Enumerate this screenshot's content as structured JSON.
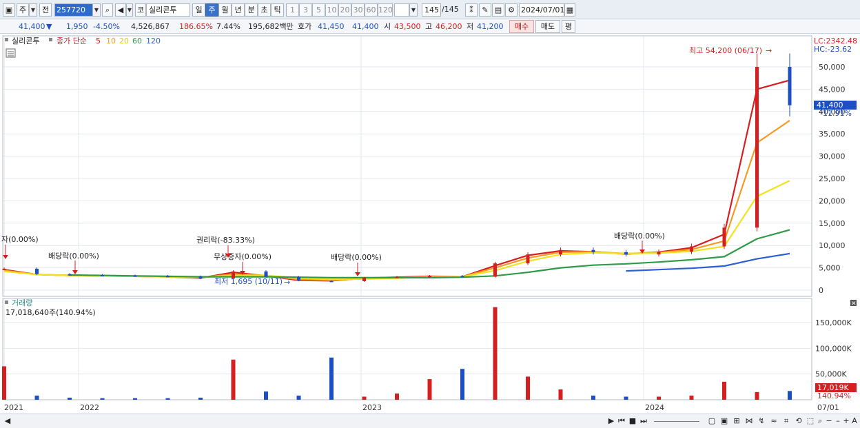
{
  "toolbar": {
    "market": "주",
    "prev": "전",
    "code": "257720",
    "corp_prefix": "코",
    "name": "실리콘투",
    "periods": [
      "일",
      "주",
      "월",
      "년",
      "분",
      "초",
      "틱"
    ],
    "active_period": "주",
    "intervals": [
      "1",
      "3",
      "5",
      "10",
      "20",
      "30",
      "60",
      "120"
    ],
    "count": "145",
    "count_total": "/145",
    "date": "2024/07/01"
  },
  "quote": {
    "price": "41,400",
    "change": "1,950",
    "change_rate": "-4.50%",
    "volume": "4,526,867",
    "vol_ratio": "186.65%",
    "turnover": "7.44%",
    "amount": "195,682백만",
    "hoga_label": "호가",
    "ask": "41,450",
    "bid": "41,400",
    "open_label": "시",
    "open": "43,500",
    "high_label": "고",
    "high": "46,200",
    "low_label": "저",
    "low": "41,200",
    "buy": "매수",
    "sell": "매도",
    "eval": "평"
  },
  "chart": {
    "legend_name": "실리콘투",
    "ma_label": "종가 단순",
    "ma_periods": [
      {
        "label": "5",
        "color": "#d81e1e"
      },
      {
        "label": "10",
        "color": "#f59a25"
      },
      {
        "label": "20",
        "color": "#f2e21d"
      },
      {
        "label": "60",
        "color": "#2f9a48"
      },
      {
        "label": "120",
        "color": "#2c5fd4"
      }
    ],
    "lc": "LC:2342.48",
    "hc": "HC:-23.62",
    "price_tag": "41,400",
    "pct_tag": "-11.91%",
    "high_annotation": "최고 54,200 (06/17)",
    "low_annotation": "최저 1,695 (10/11)",
    "volume_title": "거래량",
    "volume_value": "17,018,640주(140.94%)",
    "volume_tag": "17,019K",
    "volume_pct_tag": "140.94%"
  },
  "events": [
    {
      "label": "자(0.00%)"
    },
    {
      "label": "배당락(0.00%)"
    },
    {
      "label": "권리락(-83.33%)"
    },
    {
      "label": "무상증자(0.00%)"
    },
    {
      "label": "배당락(0.00%)"
    },
    {
      "label": "배당락(0.00%)"
    }
  ],
  "chart_data": {
    "type": "line",
    "x_labels": [
      "2021",
      "2022",
      "2023",
      "2024",
      "07/01"
    ],
    "price_ticks": [
      "50,000",
      "45,000",
      "40,000",
      "35,000",
      "30,000",
      "25,000",
      "20,000",
      "15,000",
      "10,000",
      "5,000",
      "0"
    ],
    "price_ylim": [
      0,
      54200
    ],
    "volume_ticks": [
      "150,000K",
      "100,000K",
      "50,000K"
    ],
    "volume_ylim": [
      0,
      180000
    ],
    "x": [
      "2021-01",
      "2021-03",
      "2021-06",
      "2021-09",
      "2022-01",
      "2022-03",
      "2022-06",
      "2022-08",
      "2022-09",
      "2022-10",
      "2022-11",
      "2022-12",
      "2023-01",
      "2023-03",
      "2023-04",
      "2023-06",
      "2023-08",
      "2023-10",
      "2023-12",
      "2024-01",
      "2024-03",
      "2024-04",
      "2024-05",
      "2024-06",
      "2024-07"
    ],
    "close": [
      4800,
      3600,
      3400,
      3300,
      3200,
      3100,
      2600,
      4200,
      3000,
      2100,
      2000,
      2800,
      3000,
      3200,
      3000,
      6000,
      8000,
      9000,
      8500,
      8000,
      8600,
      9800,
      14000,
      50000,
      41400
    ],
    "series": [
      {
        "name": "5",
        "values": [
          4600,
          3500,
          3300,
          3200,
          3100,
          3000,
          2700,
          4000,
          3200,
          2200,
          2100,
          2700,
          2900,
          3100,
          3000,
          5500,
          7800,
          8800,
          8600,
          8100,
          8500,
          9500,
          12500,
          45000,
          47000
        ]
      },
      {
        "name": "10",
        "values": [
          4400,
          3500,
          3300,
          3200,
          3100,
          3000,
          2800,
          3600,
          3300,
          2400,
          2200,
          2600,
          2800,
          3000,
          3000,
          5000,
          7200,
          8500,
          8600,
          8200,
          8400,
          9100,
          11000,
          33000,
          38000
        ]
      },
      {
        "name": "20",
        "values": [
          4200,
          3500,
          3300,
          3200,
          3100,
          3000,
          2900,
          3300,
          3300,
          2700,
          2400,
          2500,
          2700,
          2900,
          3000,
          4400,
          6500,
          8000,
          8400,
          8200,
          8300,
          8700,
          9800,
          21000,
          24500
        ]
      },
      {
        "name": "60",
        "values": [
          null,
          null,
          3400,
          3300,
          3200,
          3100,
          3000,
          3000,
          3000,
          2900,
          2800,
          2800,
          2800,
          2800,
          2900,
          3200,
          4000,
          5000,
          5600,
          5900,
          6300,
          6800,
          7500,
          11500,
          13500
        ]
      },
      {
        "name": "120",
        "values": [
          null,
          null,
          null,
          null,
          null,
          null,
          null,
          null,
          null,
          null,
          null,
          null,
          null,
          null,
          null,
          null,
          null,
          null,
          null,
          4300,
          4600,
          4900,
          5400,
          7000,
          8200
        ]
      }
    ],
    "volume": [
      65000,
      8000,
      4000,
      3000,
      3000,
      3000,
      4000,
      78000,
      16000,
      8000,
      82000,
      6000,
      12000,
      40000,
      60000,
      180000,
      45000,
      20000,
      8000,
      6000,
      6000,
      8000,
      35000,
      15000,
      17019
    ]
  }
}
